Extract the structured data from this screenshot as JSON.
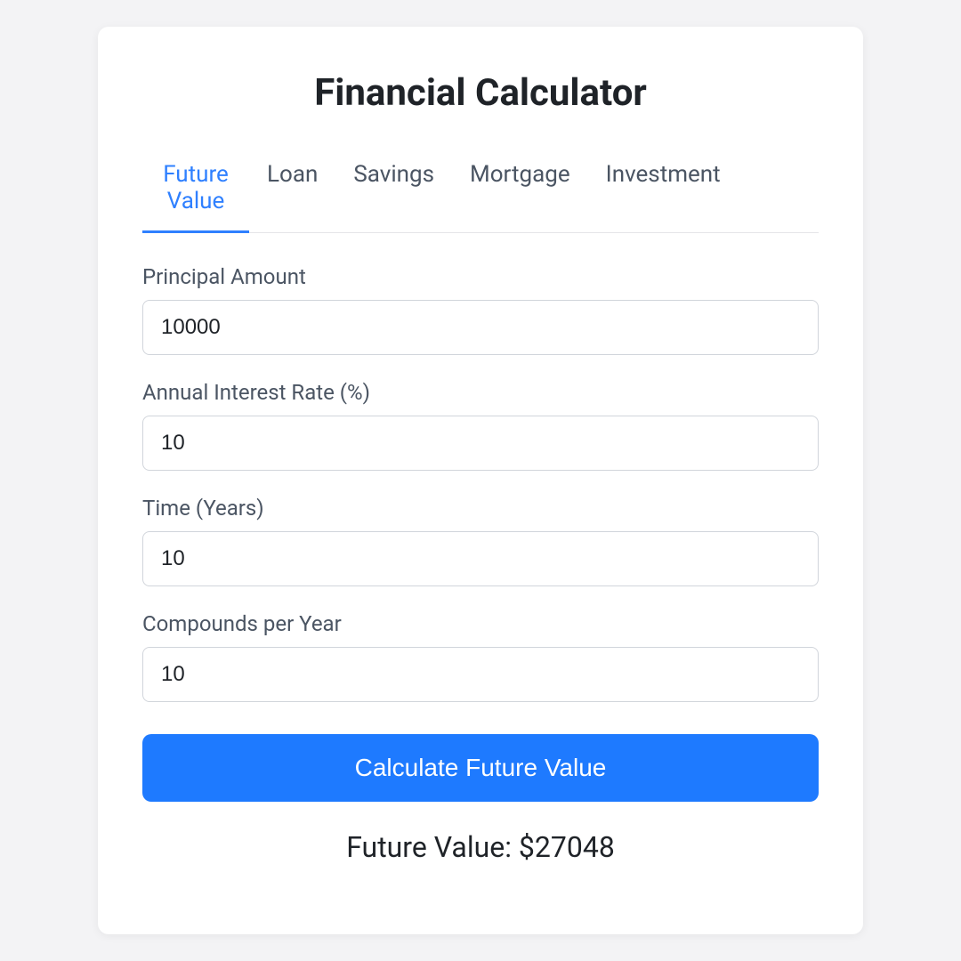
{
  "title": "Financial Calculator",
  "tabs": {
    "future_value": "Future Value",
    "loan": "Loan",
    "savings": "Savings",
    "mortgage": "Mortgage",
    "investment": "Investment"
  },
  "fields": {
    "principal": {
      "label": "Principal Amount",
      "value": "10000"
    },
    "rate": {
      "label": "Annual Interest Rate (%)",
      "value": "10"
    },
    "time": {
      "label": "Time (Years)",
      "value": "10"
    },
    "compounds": {
      "label": "Compounds per Year",
      "value": "10"
    }
  },
  "button": "Calculate Future Value",
  "result": "Future Value: $27048"
}
